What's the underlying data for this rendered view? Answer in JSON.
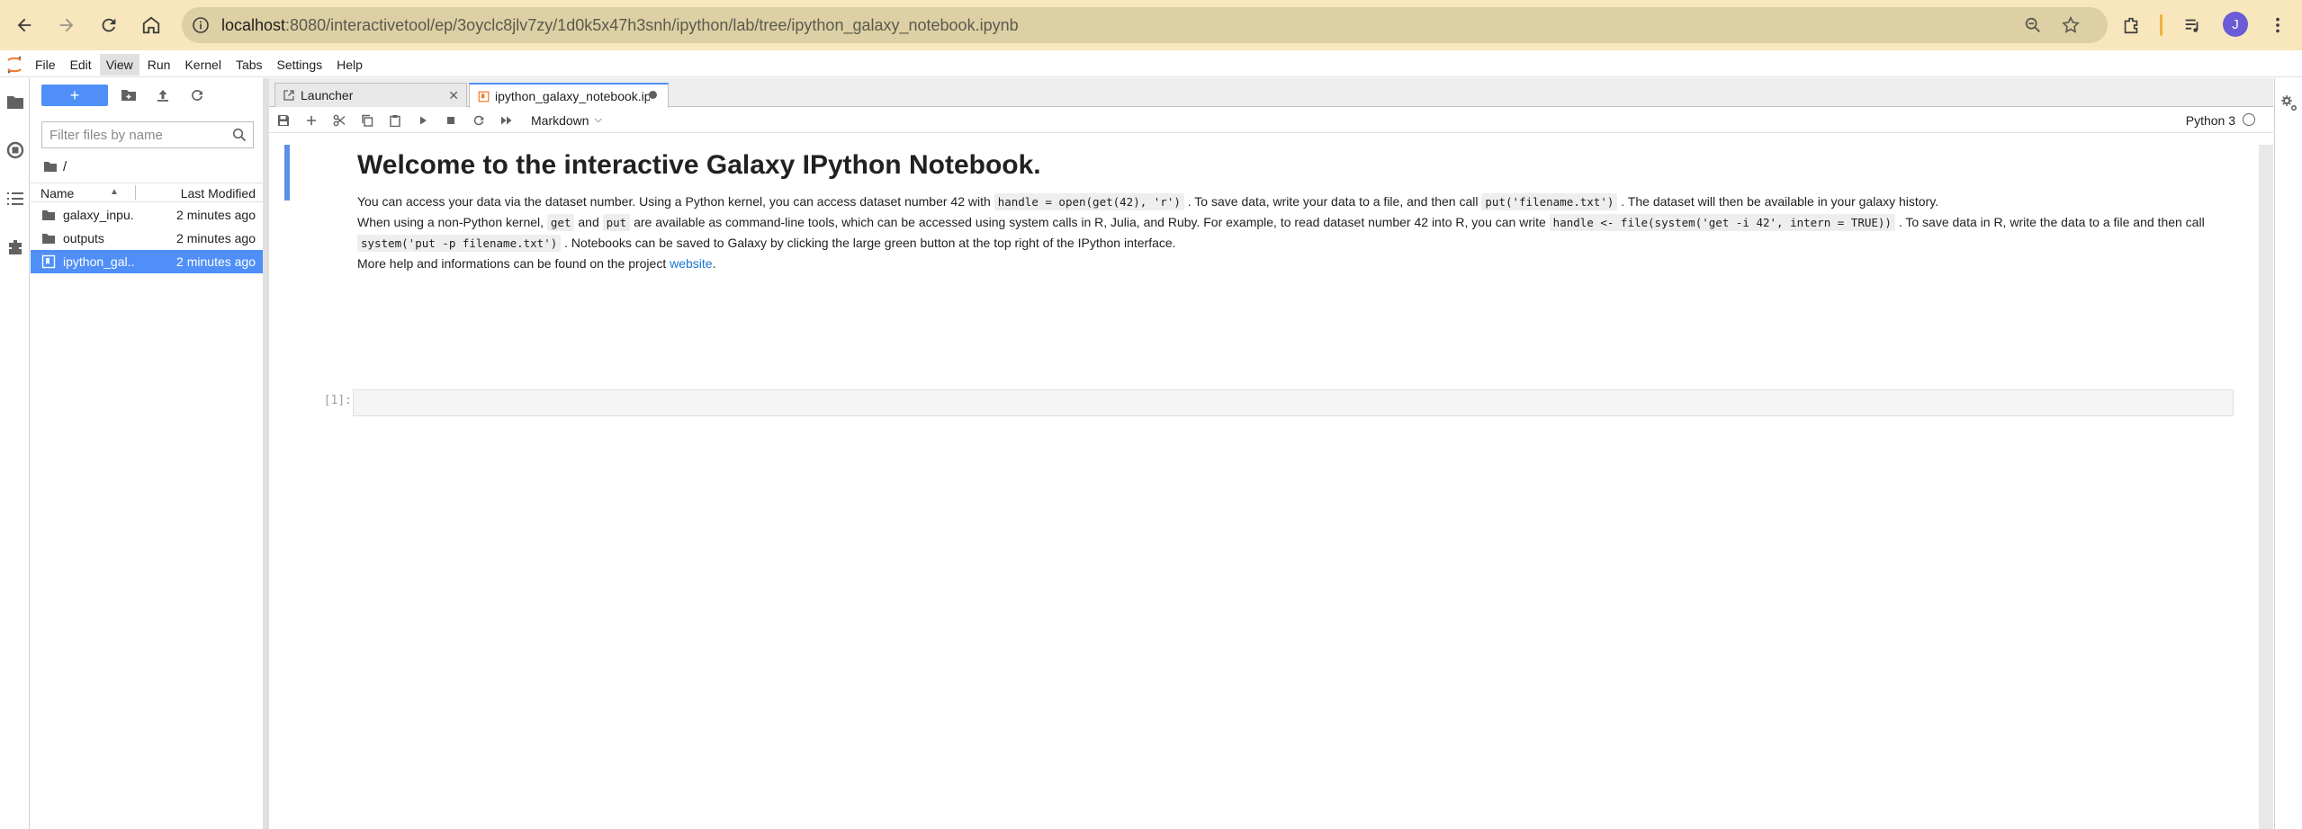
{
  "browser": {
    "url_host": "localhost",
    "url_path": ":8080/interactivetool/ep/3oyclc8jlv7zy/1d0k5x47h3snh/ipython/lab/tree/ipython_galaxy_notebook.ipynb",
    "profile_initial": "J",
    "icons": [
      "back-icon",
      "forward-icon",
      "reload-icon",
      "home-icon",
      "site-info-icon",
      "zoom-icon",
      "bookmark-star-icon",
      "extensions-icon",
      "media-icon",
      "menu-kebab-icon"
    ]
  },
  "menubar": {
    "items": [
      "File",
      "Edit",
      "View",
      "Run",
      "Kernel",
      "Tabs",
      "Settings",
      "Help"
    ],
    "active": "View"
  },
  "file_browser": {
    "new_label": "+",
    "filter_placeholder": "Filter files by name",
    "breadcrumb": "/",
    "columns": {
      "name": "Name",
      "modified": "Last Modified"
    },
    "files": [
      {
        "name": "galaxy_inpu...",
        "modified": "2 minutes ago",
        "type": "folder"
      },
      {
        "name": "outputs",
        "modified": "2 minutes ago",
        "type": "folder"
      },
      {
        "name": "ipython_gal...",
        "modified": "2 minutes ago",
        "type": "notebook",
        "selected": true
      }
    ]
  },
  "tabs": [
    {
      "label": "Launcher",
      "active": false
    },
    {
      "label": "ipython_galaxy_notebook.ipynb",
      "active": true
    }
  ],
  "toolbar": {
    "cell_type": "Markdown",
    "kernel": "Python 3"
  },
  "notebook": {
    "title": "Welcome to the interactive Galaxy IPython Notebook.",
    "p1_a": "You can access your data via the dataset number. Using a Python kernel, you can access dataset number 42 with ",
    "p1_code1": "handle = open(get(42), 'r')",
    "p1_b": " . To save data, write your data to a file, and then call ",
    "p1_code2": "put('filename.txt')",
    "p1_c": " . The dataset will then be available in your galaxy history.",
    "p2_a": "When using a non-Python kernel, ",
    "p2_code1": "get",
    "p2_b": " and ",
    "p2_code2": "put",
    "p2_c": " are available as command-line tools, which can be accessed using system calls in R, Julia, and Ruby. For example, to read dataset number 42 into R, you can write ",
    "p2_code3": "handle <- file(system('get -i 42', intern = TRUE))",
    "p2_d": " . To save data in R, write the data to a file and then call ",
    "p2_code4": "system('put -p filename.txt')",
    "p2_e": " . Notebooks can be saved to Galaxy by clicking the large green button at the top right of the IPython interface.",
    "p3_a": "More help and informations can be found on the project ",
    "p3_link": "website",
    "p3_b": ".",
    "code_prompt": "[1]:"
  },
  "colors": {
    "accent": "#4f8ff7",
    "chrome_bg": "#f8e6bd",
    "url_bg": "#ddd0a4",
    "link": "#1976d2"
  }
}
